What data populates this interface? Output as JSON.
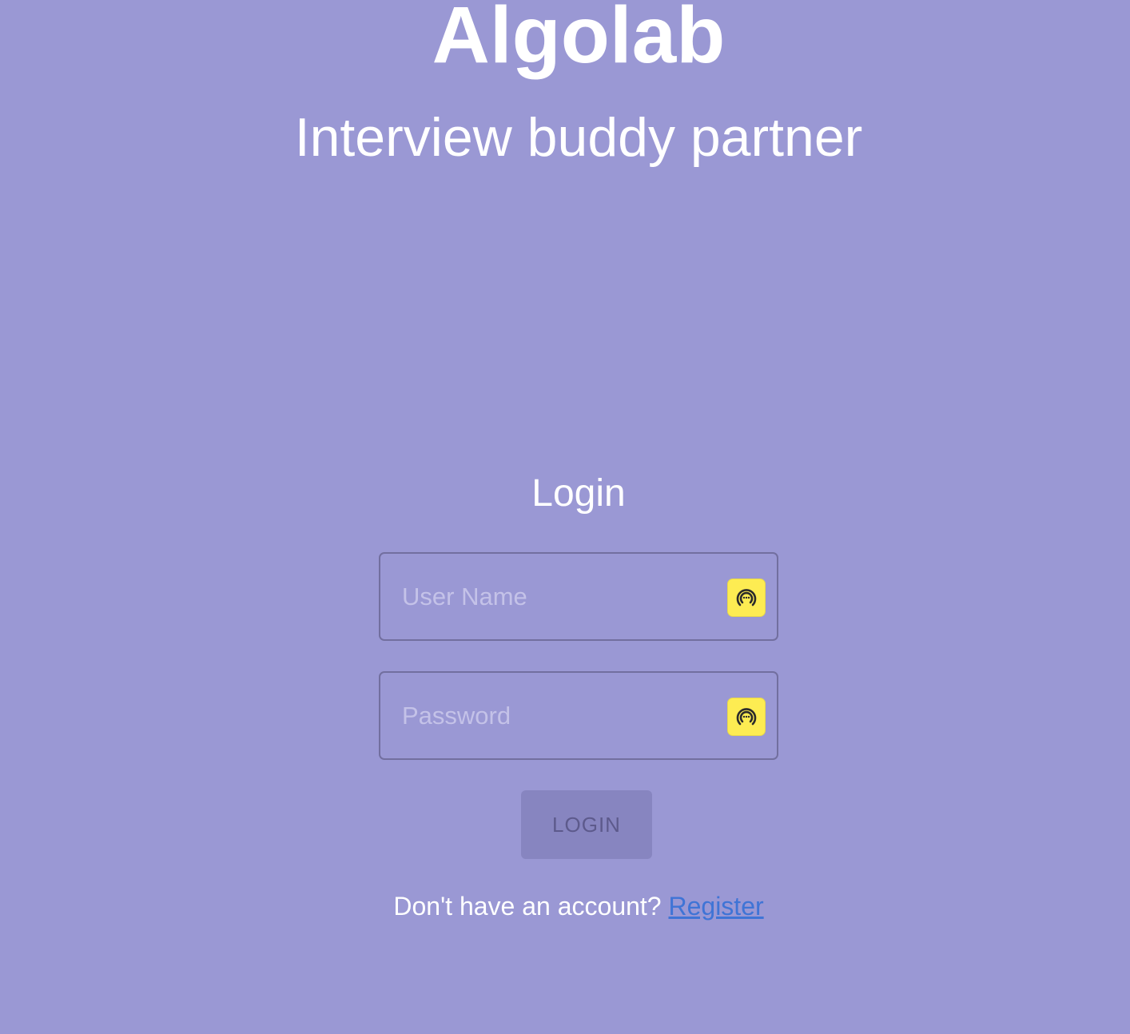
{
  "header": {
    "title": "Algolab",
    "subtitle": "Interview buddy partner"
  },
  "login_form": {
    "heading": "Login",
    "username": {
      "placeholder": "User Name",
      "value": "",
      "icon": "password-manager-icon"
    },
    "password": {
      "placeholder": "Password",
      "value": "",
      "icon": "password-manager-icon"
    },
    "submit_label": "LOGIN",
    "register_prompt": "Don't have an account?",
    "register_link": "Register"
  },
  "colors": {
    "background": "#9a98d4",
    "text": "#ffffff",
    "field_border": "#726f9f",
    "button_bg": "#8785c0",
    "button_text": "#5d5a8c",
    "link": "#3f74d6",
    "icon_bg": "#fdec52"
  }
}
